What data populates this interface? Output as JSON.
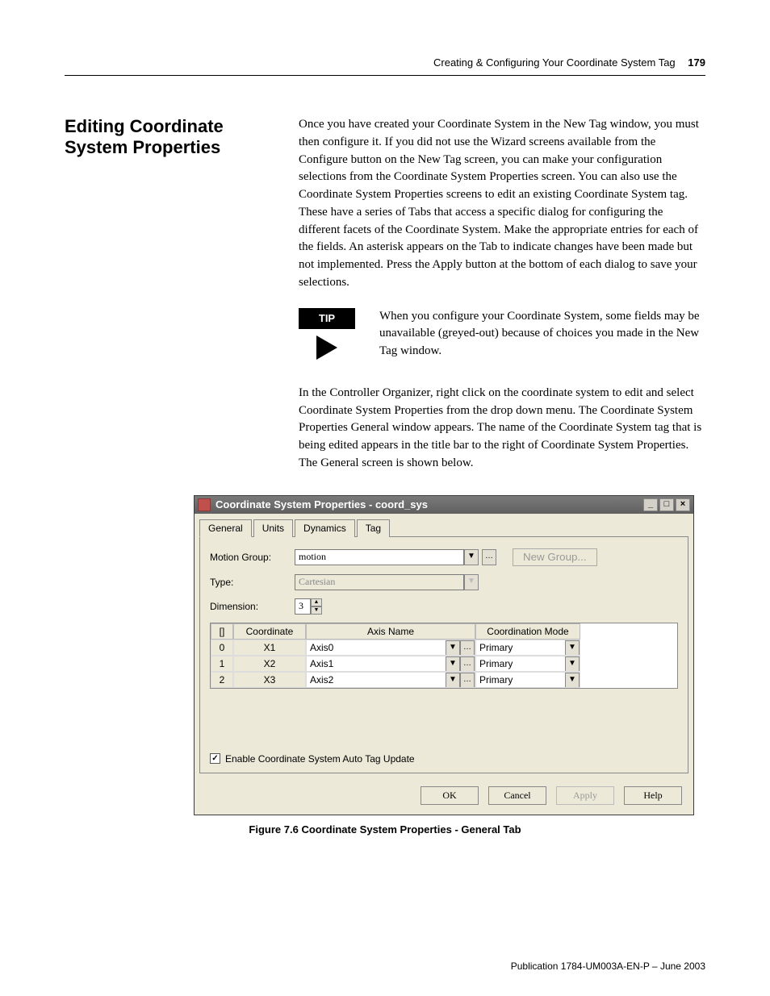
{
  "header": {
    "chapter": "Creating & Configuring Your Coordinate System Tag",
    "page": "179"
  },
  "section_title": "Editing Coordinate System Properties",
  "paragraphs": {
    "intro": "Once you have created your Coordinate System in the New Tag window, you must then configure it. If you did not use the Wizard screens available from the Configure button on the New Tag screen, you can make your configuration selections from the Coordinate System Properties screen. You can also use the Coordinate System Properties screens to edit an existing Coordinate System tag. These have a series of Tabs that access a specific dialog for configuring the different facets of the Coordinate System. Make the appropriate entries for each of the fields. An asterisk appears on the Tab to indicate changes have been made but not implemented. Press the Apply button at the bottom of each dialog to save your selections.",
    "organizer": "In the Controller Organizer, right click on the coordinate system to edit and select Coordinate System Properties from the drop down menu. The Coordinate System Properties General window appears. The name of the Coordinate System tag that is being edited appears in the title bar to the right of Coordinate System Properties. The General screen is shown below."
  },
  "tip": {
    "label": "TIP",
    "text": "When you configure your Coordinate System, some fields may be unavailable (greyed-out) because of choices you made in the New Tag window."
  },
  "dialog": {
    "title": "Coordinate System Properties - coord_sys",
    "tabs": [
      "General",
      "Units",
      "Dynamics",
      "Tag"
    ],
    "active_tab": "General",
    "fields": {
      "motion_group_label": "Motion Group:",
      "motion_group_value": "motion",
      "new_group_btn": "New Group...",
      "type_label": "Type:",
      "type_value": "Cartesian",
      "dimension_label": "Dimension:",
      "dimension_value": "3"
    },
    "grid": {
      "headers": {
        "idx": "[]",
        "coord": "Coordinate",
        "axis": "Axis Name",
        "mode": "Coordination Mode"
      },
      "rows": [
        {
          "idx": "0",
          "coord": "X1",
          "axis": "Axis0",
          "mode": "Primary"
        },
        {
          "idx": "1",
          "coord": "X2",
          "axis": "Axis1",
          "mode": "Primary"
        },
        {
          "idx": "2",
          "coord": "X3",
          "axis": "Axis2",
          "mode": "Primary"
        }
      ]
    },
    "checkbox_label": "Enable Coordinate System Auto Tag Update",
    "checkbox_checked": "✓",
    "buttons": {
      "ok": "OK",
      "cancel": "Cancel",
      "apply": "Apply",
      "help": "Help"
    }
  },
  "figure_caption": "Figure 7.6 Coordinate System Properties - General Tab",
  "footer": "Publication 1784-UM003A-EN-P – June 2003"
}
